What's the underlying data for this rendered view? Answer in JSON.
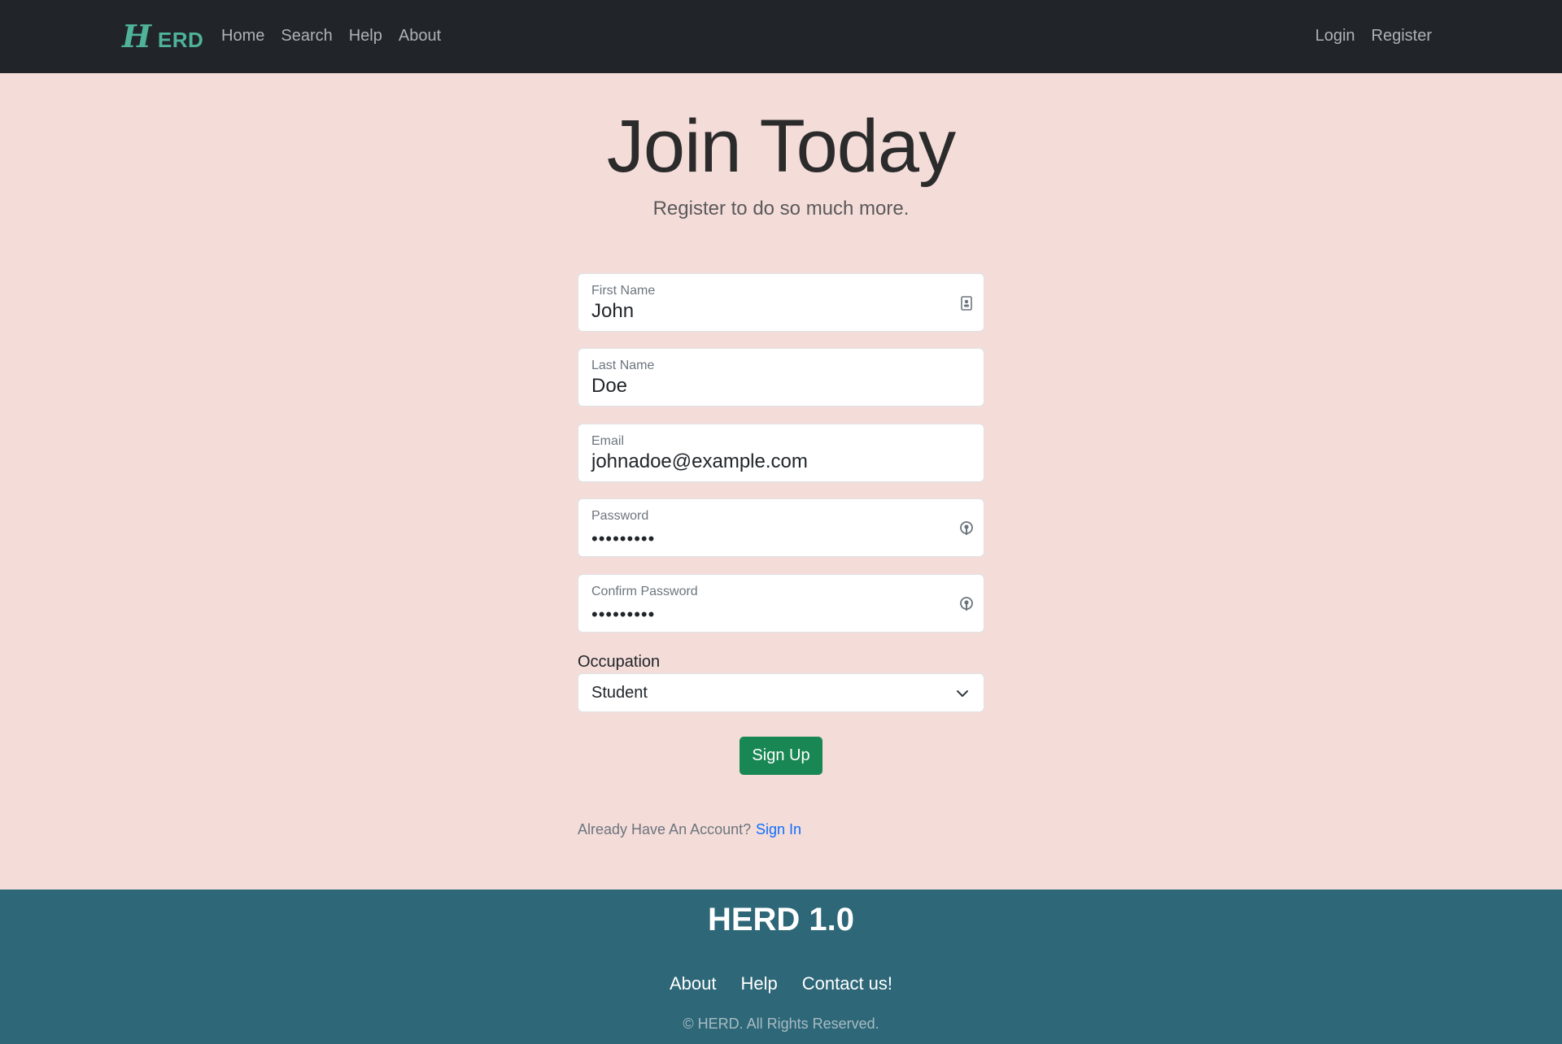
{
  "brand": {
    "logo_letter": "H",
    "name": "ERD",
    "color": "#4fb39a"
  },
  "nav": {
    "left": [
      "Home",
      "Search",
      "Help",
      "About"
    ],
    "right": [
      "Login",
      "Register"
    ]
  },
  "hero": {
    "title": "Join Today",
    "subtitle": "Register to do so much more."
  },
  "form": {
    "first_name": {
      "label": "First Name",
      "value": "John",
      "icon": "contact-card-icon"
    },
    "last_name": {
      "label": "Last Name",
      "value": "Doe"
    },
    "email": {
      "label": "Email",
      "value": "johnadoe@example.com"
    },
    "password": {
      "label": "Password",
      "value": "•••••••••",
      "icon": "key-icon"
    },
    "confirm_password": {
      "label": "Confirm Password",
      "value": "•••••••••",
      "icon": "key-icon"
    },
    "occupation": {
      "label": "Occupation",
      "selected": "Student"
    },
    "submit_label": "Sign Up",
    "submit_color": "#198754"
  },
  "signin": {
    "prompt": "Already Have An Account?",
    "link": "Sign In"
  },
  "footer": {
    "title": "HERD 1.0",
    "links": [
      "About",
      "Help",
      "Contact us!"
    ],
    "copyright": "© HERD. All Rights Reserved.",
    "background": "#2d6778"
  }
}
